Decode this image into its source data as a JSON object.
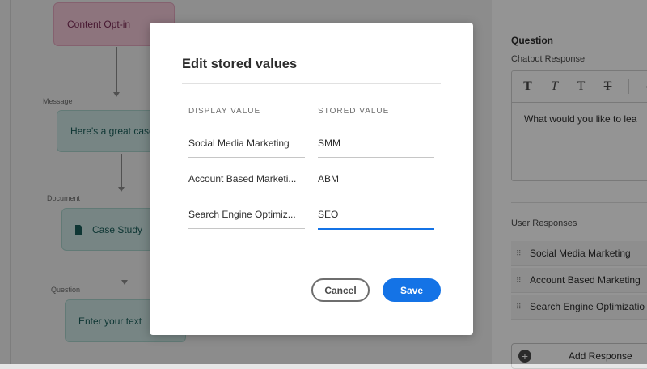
{
  "canvas": {
    "nodes": [
      {
        "type": "",
        "label": "Content Opt-in",
        "icon": ""
      },
      {
        "type": "Message",
        "label": "Here's a great case",
        "icon": ""
      },
      {
        "type": "Document",
        "label": "Case Study",
        "icon": "document-icon"
      },
      {
        "type": "Question",
        "label": "Enter your text",
        "icon": ""
      }
    ]
  },
  "panel": {
    "title": "Question",
    "editor_label": "Chatbot Response",
    "toolbar": {
      "bold": "T",
      "italic": "T",
      "underline": "T",
      "strike": "T"
    },
    "editor_text": "What would you like to lea",
    "responses_label": "User Responses",
    "responses": [
      "Social Media Marketing",
      "Account Based Marketing",
      "Search Engine Optimizatio"
    ],
    "add_response": "Add Response"
  },
  "dialog": {
    "title": "Edit stored values",
    "col_display": "DISPLAY VALUE",
    "col_stored": "STORED VALUE",
    "rows": [
      {
        "display": "Social Media Marketing",
        "stored": "SMM"
      },
      {
        "display": "Account Based Marketi...",
        "stored": "ABM"
      },
      {
        "display": "Search Engine Optimiz...",
        "stored": "SEO"
      }
    ],
    "cancel": "Cancel",
    "save": "Save"
  },
  "colors": {
    "accent": "#1473e6",
    "node_teal": "#cde6e3",
    "node_pink": "#f3c8d8"
  }
}
